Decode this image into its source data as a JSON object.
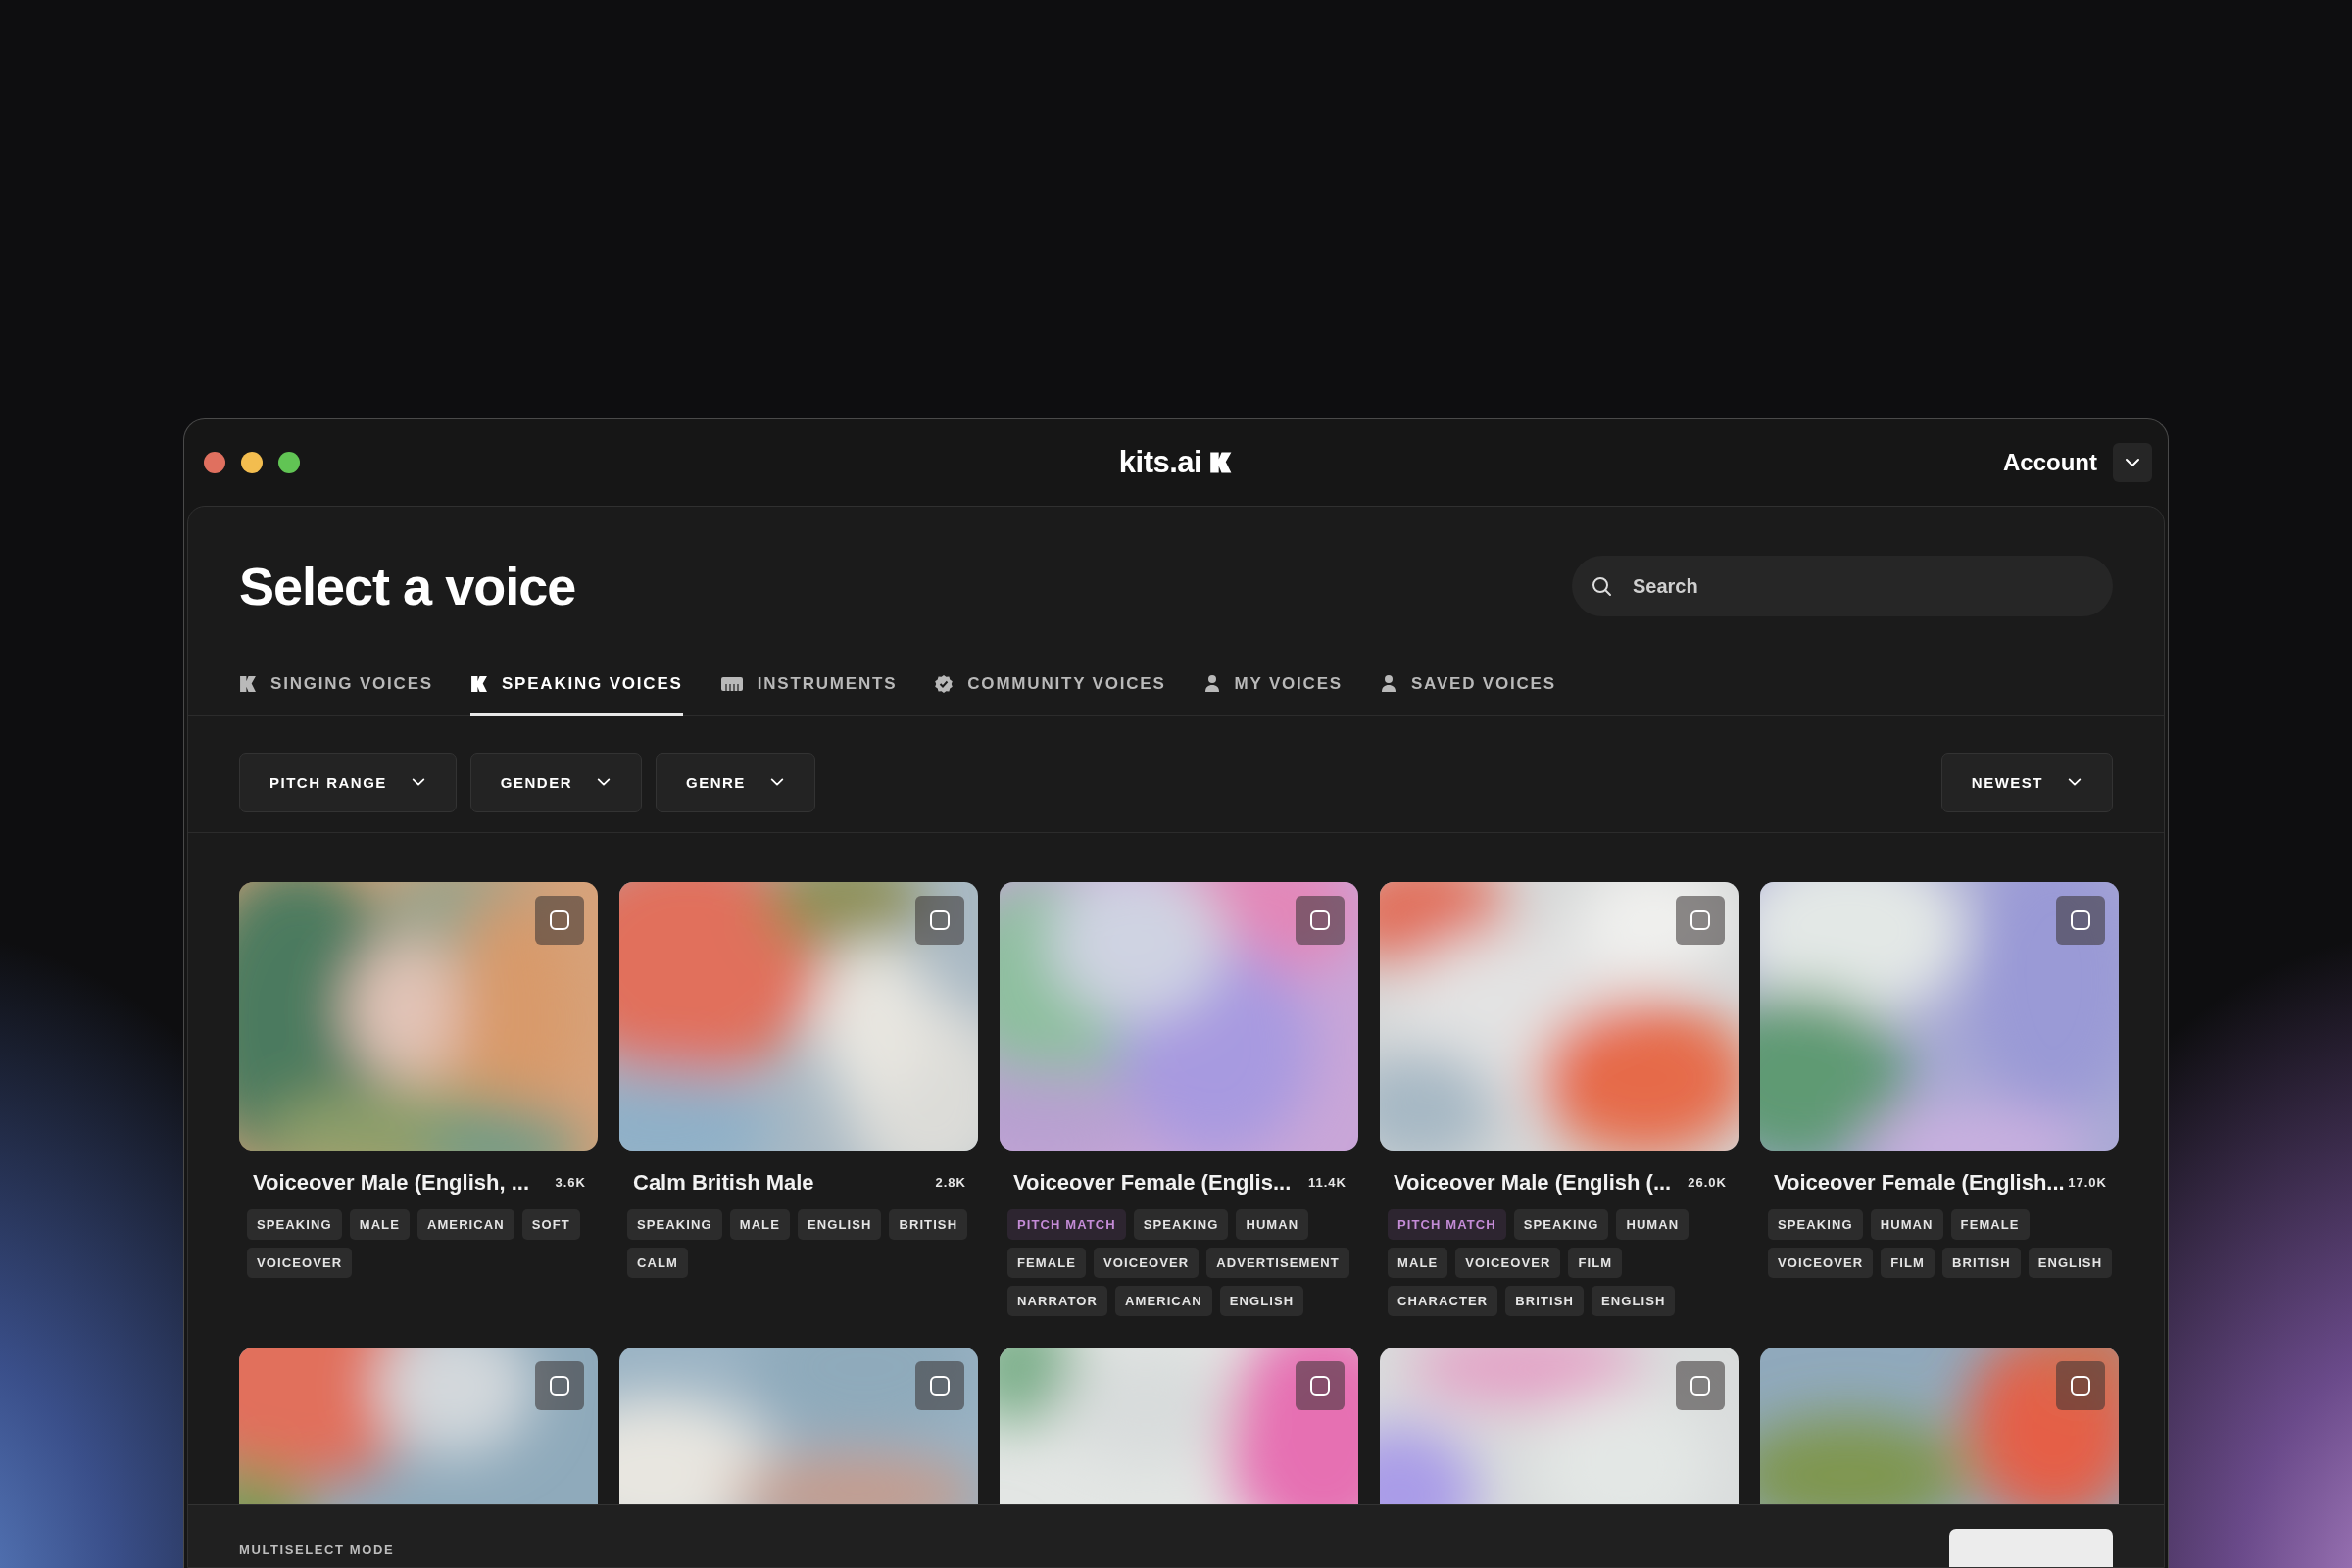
{
  "window": {
    "logo": "kits.ai",
    "account": "Account"
  },
  "heading": "Select a voice",
  "search": {
    "placeholder": "Search"
  },
  "tabs": [
    {
      "label": "SINGING VOICES",
      "kind": "logo",
      "selected": false
    },
    {
      "label": "SPEAKING VOICES",
      "kind": "logo",
      "selected": true
    },
    {
      "label": "INSTRUMENTS",
      "kind": "piano",
      "selected": false
    },
    {
      "label": "COMMUNITY VOICES",
      "kind": "badge",
      "selected": false
    },
    {
      "label": "MY VOICES",
      "kind": "person",
      "selected": false
    },
    {
      "label": "SAVED VOICES",
      "kind": "person",
      "selected": false
    }
  ],
  "filters": [
    "PITCH RANGE",
    "GENDER",
    "GENRE"
  ],
  "sort": "NEWEST",
  "cards": [
    {
      "title": "Voiceover Male (English, ...",
      "count": "3.6K",
      "checked": false,
      "tags": [
        {
          "label": "SPEAKING",
          "highlight": false
        },
        {
          "label": "MALE",
          "highlight": false
        },
        {
          "label": "AMERICAN",
          "highlight": false
        },
        {
          "label": "SOFT",
          "highlight": false
        },
        {
          "label": "VOICEOVER",
          "highlight": false
        }
      ]
    },
    {
      "title": "Calm British Male",
      "count": "2.8K",
      "checked": false,
      "tags": [
        {
          "label": "SPEAKING",
          "highlight": false
        },
        {
          "label": "MALE",
          "highlight": false
        },
        {
          "label": "ENGLISH",
          "highlight": false
        },
        {
          "label": "BRITISH",
          "highlight": false
        },
        {
          "label": "CALM",
          "highlight": false
        }
      ]
    },
    {
      "title": "Voiceover Female (Englis...",
      "count": "11.4K",
      "checked": false,
      "tags": [
        {
          "label": "PITCH MATCH",
          "highlight": true
        },
        {
          "label": "SPEAKING",
          "highlight": false
        },
        {
          "label": "HUMAN",
          "highlight": false
        },
        {
          "label": "FEMALE",
          "highlight": false
        },
        {
          "label": "VOICEOVER",
          "highlight": false
        },
        {
          "label": "ADVERTISEMENT",
          "highlight": false
        },
        {
          "label": "NARRATOR",
          "highlight": false
        },
        {
          "label": "AMERICAN",
          "highlight": false
        },
        {
          "label": "ENGLISH",
          "highlight": false
        }
      ]
    },
    {
      "title": "Voiceover Male (English (...",
      "count": "26.0K",
      "checked": false,
      "tags": [
        {
          "label": "PITCH MATCH",
          "highlight": true
        },
        {
          "label": "SPEAKING",
          "highlight": false
        },
        {
          "label": "HUMAN",
          "highlight": false
        },
        {
          "label": "MALE",
          "highlight": false
        },
        {
          "label": "VOICEOVER",
          "highlight": false
        },
        {
          "label": "FILM",
          "highlight": false
        },
        {
          "label": "CHARACTER",
          "highlight": false
        },
        {
          "label": "BRITISH",
          "highlight": false
        },
        {
          "label": "ENGLISH",
          "highlight": false
        }
      ]
    },
    {
      "title": "Voiceover Female (English...",
      "count": "17.0K",
      "checked": false,
      "tags": [
        {
          "label": "SPEAKING",
          "highlight": false
        },
        {
          "label": "HUMAN",
          "highlight": false
        },
        {
          "label": "FEMALE",
          "highlight": false
        },
        {
          "label": "VOICEOVER",
          "highlight": false
        },
        {
          "label": "FILM",
          "highlight": false
        },
        {
          "label": "BRITISH",
          "highlight": false
        },
        {
          "label": "ENGLISH",
          "highlight": false
        }
      ]
    },
    {
      "checked": false
    },
    {
      "checked": false
    },
    {
      "checked": false
    },
    {
      "checked": false
    },
    {
      "checked": false
    }
  ],
  "footer": {
    "label": "MULTISELECT MODE"
  }
}
